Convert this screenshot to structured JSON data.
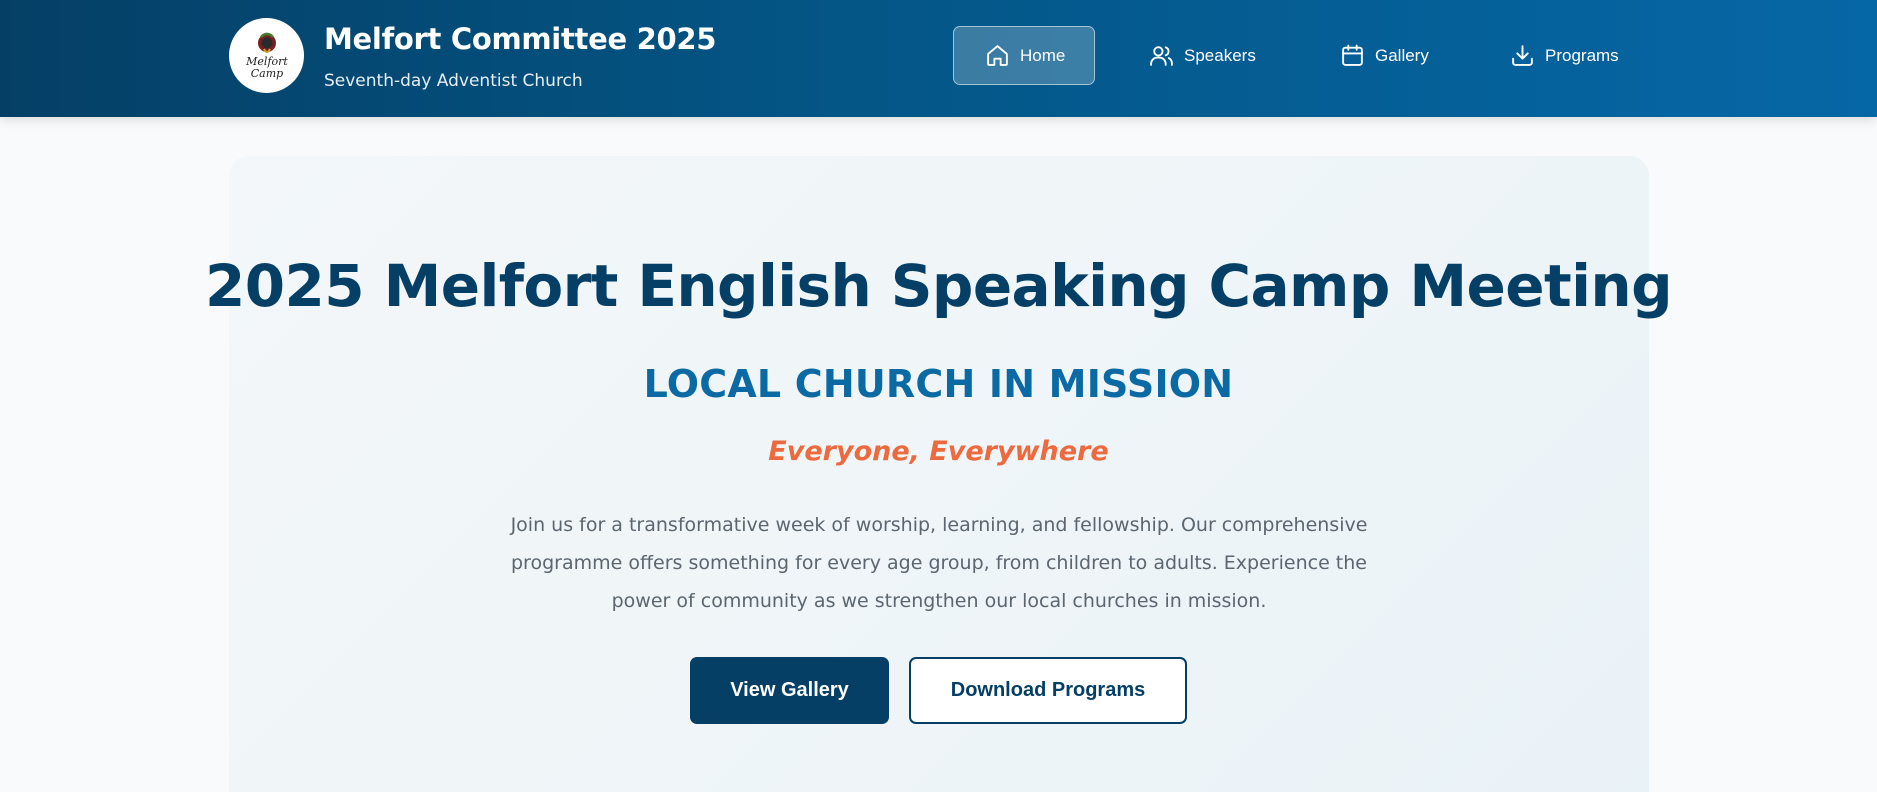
{
  "header": {
    "logo": {
      "icon": "melfort-camp-logo",
      "text_line1": "Melfort",
      "text_line2": "Camp"
    },
    "title": "Melfort Committee 2025",
    "subtitle": "Seventh-day Adventist Church"
  },
  "nav": {
    "items": [
      {
        "label": "Home",
        "icon": "home-icon",
        "active": true
      },
      {
        "label": "Speakers",
        "icon": "users-icon",
        "active": false
      },
      {
        "label": "Gallery",
        "icon": "calendar-icon",
        "active": false
      },
      {
        "label": "Programs",
        "icon": "download-icon",
        "active": false
      }
    ]
  },
  "hero": {
    "title": "2025 Melfort English Speaking Camp Meeting",
    "theme": "LOCAL CHURCH IN MISSION",
    "tagline": "Everyone, Everywhere",
    "description": "Join us for a transformative week of worship, learning, and fellowship. Our comprehensive programme offers something for every age group, from children to adults. Experience the power of community as we strengthen our local churches in mission.",
    "primary_button": "View Gallery",
    "secondary_button": "Download Programs"
  },
  "colors": {
    "header_dark": "#053f66",
    "header_light": "#0667a6",
    "title": "#053f66",
    "theme": "#0b69a3",
    "tagline": "#ec6a3d",
    "body_text": "#5b6670"
  }
}
